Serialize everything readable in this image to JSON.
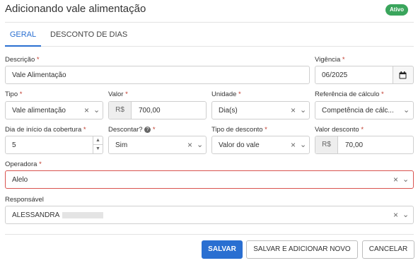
{
  "window": {
    "title": "Adicionando vale alimentação",
    "status_badge": "Ativo",
    "status_color": "#3aa55c"
  },
  "tabs": [
    {
      "label": "GERAL",
      "active": true
    },
    {
      "label": "DESCONTO DE DIAS",
      "active": false
    }
  ],
  "form": {
    "descricao": {
      "label": "Descrição",
      "required": "*",
      "value": "Vale Alimentação"
    },
    "vigencia": {
      "label": "Vigência",
      "required": "*",
      "value": "06/2025"
    },
    "tipo": {
      "label": "Tipo",
      "required": "*",
      "value": "Vale alimentação"
    },
    "valor": {
      "label": "Valor",
      "required": "*",
      "prefix": "R$",
      "value": "700,00"
    },
    "unidade": {
      "label": "Unidade",
      "required": "*",
      "value": "Dia(s)"
    },
    "referencia": {
      "label": "Referência de cálculo",
      "required": "*",
      "value": "Competência de cálc..."
    },
    "dia_inicio": {
      "label": "Dia de início da cobertura",
      "required": "*",
      "value": "5"
    },
    "descontar": {
      "label": "Descontar?",
      "required": "*",
      "value": "Sim"
    },
    "tipo_desconto": {
      "label": "Tipo de desconto",
      "required": "*",
      "value": "Valor do vale"
    },
    "valor_desconto": {
      "label": "Valor desconto",
      "required": "*",
      "prefix": "R$",
      "value": "70,00"
    },
    "operadora": {
      "label": "Operadora",
      "required": "*",
      "value": "Alelo"
    },
    "responsavel": {
      "label": "Responsável",
      "value": "ALESSANDRA"
    }
  },
  "buttons": {
    "save": "SALVAR",
    "save_new": "SALVAR E ADICIONAR NOVO",
    "cancel": "CANCELAR"
  },
  "colors": {
    "accent": "#2a6fd1",
    "error": "#d9534f"
  }
}
